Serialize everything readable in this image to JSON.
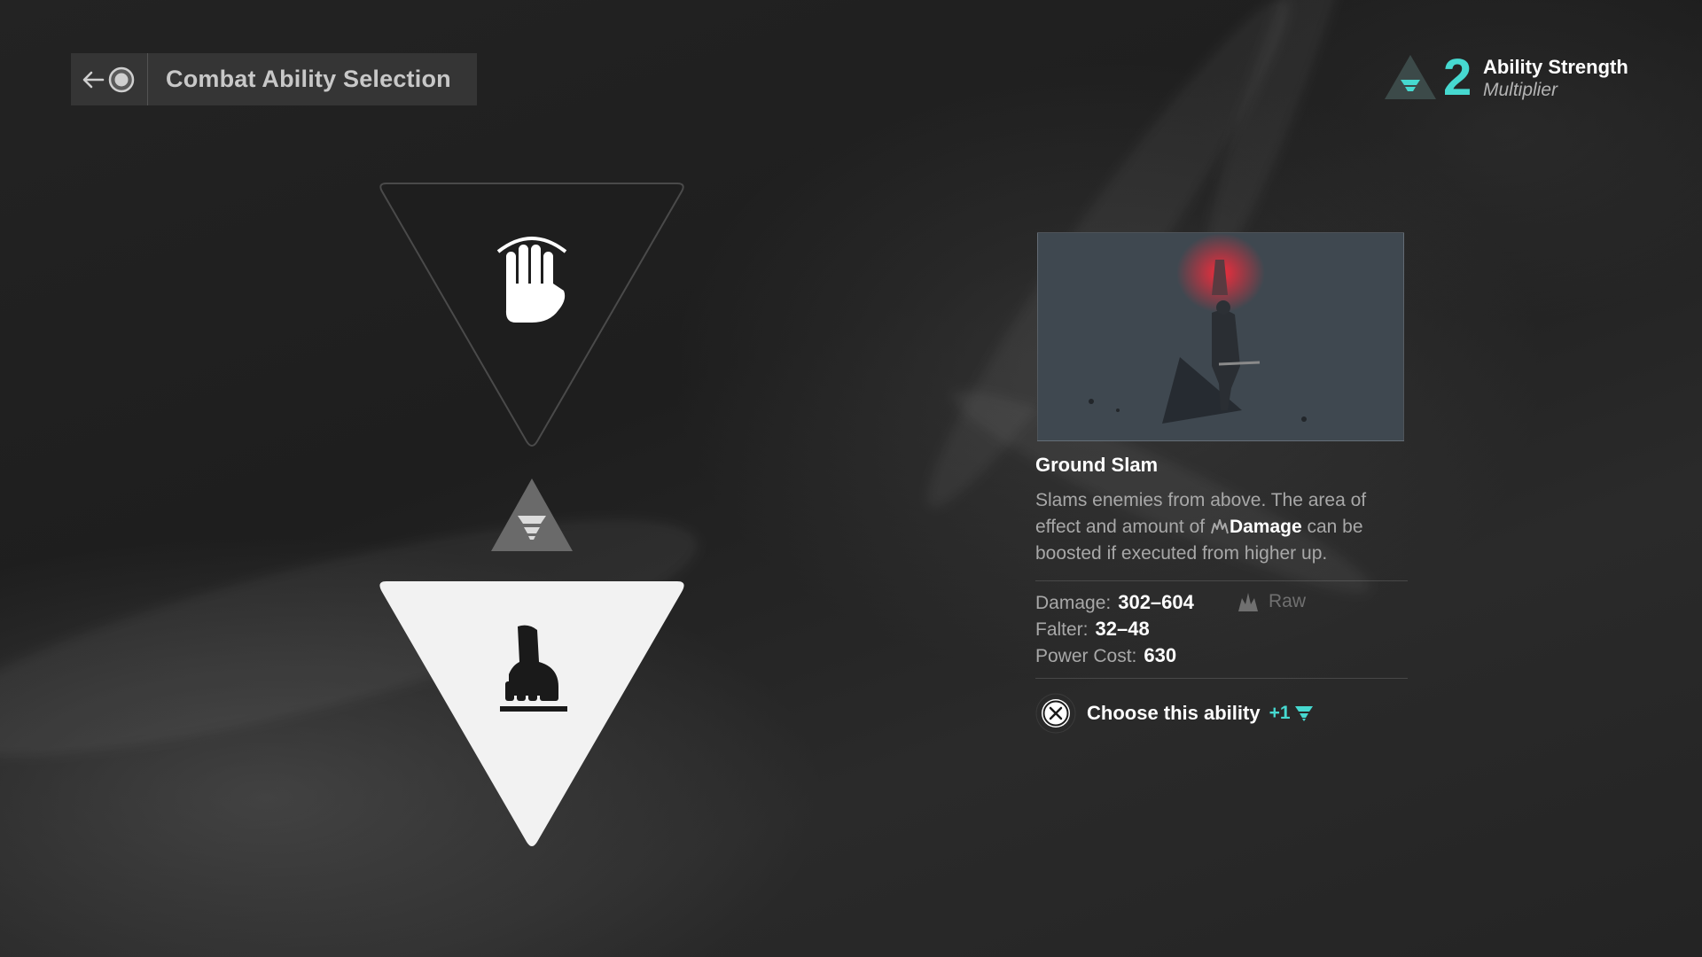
{
  "header": {
    "title": "Combat Ability Selection",
    "back_icon": "arrow-left-icon",
    "button_icon": "circle-button-icon"
  },
  "multiplier": {
    "value": "2",
    "title": "Ability Strength",
    "subtitle": "Multiplier",
    "color": "#46d9d0"
  },
  "abilities": [
    {
      "icon": "open-hand-icon",
      "selected": false
    },
    {
      "icon": "ground-slam-fist-icon",
      "selected": true
    }
  ],
  "detail": {
    "name": "Ground Slam",
    "description_before": "Slams enemies from above. The area of effect and amount of",
    "description_keyword": "Damage",
    "description_after": "can be boosted if executed from higher up.",
    "stats": {
      "damage_label": "Damage:",
      "damage_value": "302–604",
      "damage_type": "Raw",
      "falter_label": "Falter:",
      "falter_value": "32–48",
      "power_label": "Power Cost:",
      "power_value": "630"
    },
    "action": {
      "button_icon": "cross-button-icon",
      "label": "Choose this ability",
      "bonus": "+1"
    }
  }
}
